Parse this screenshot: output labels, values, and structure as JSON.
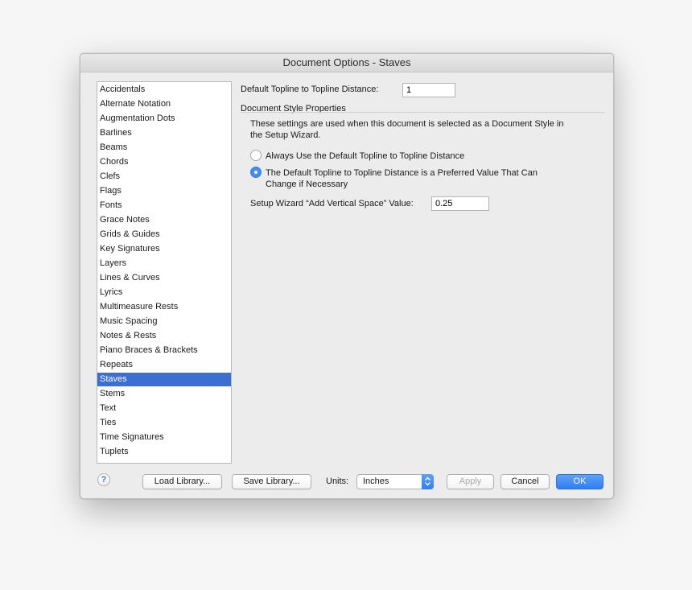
{
  "window": {
    "title": "Document Options - Staves"
  },
  "categories": [
    "Accidentals",
    "Alternate Notation",
    "Augmentation Dots",
    "Barlines",
    "Beams",
    "Chords",
    "Clefs",
    "Flags",
    "Fonts",
    "Grace Notes",
    "Grids & Guides",
    "Key Signatures",
    "Layers",
    "Lines & Curves",
    "Lyrics",
    "Multimeasure Rests",
    "Music Spacing",
    "Notes & Rests",
    "Piano Braces & Brackets",
    "Repeats",
    "Staves",
    "Stems",
    "Text",
    "Ties",
    "Time Signatures",
    "Tuplets"
  ],
  "selected_category": "Staves",
  "settings": {
    "topline_label": "Default Topline to Topline Distance:",
    "topline_value": "1",
    "section_title": "Document Style Properties",
    "description": "These settings are used when this document is selected as a Document Style in the Setup Wizard.",
    "radio_always_label": "Always Use the Default Topline to Topline Distance",
    "radio_preferred_label_line1": "The Default Topline to Topline Distance is a Preferred Value That Can",
    "radio_preferred_label_line2": "Change if Necessary",
    "selected_radio": "preferred",
    "wizard_label": "Setup Wizard “Add Vertical Space” Value:",
    "wizard_value": "0.25"
  },
  "footer": {
    "help_symbol": "?",
    "load_library": "Load Library...",
    "save_library": "Save Library...",
    "units_label": "Units:",
    "units_value": "Inches",
    "apply": "Apply",
    "cancel": "Cancel",
    "ok": "OK"
  },
  "colors": {
    "selection": "#3c6fd3",
    "accent": "#3f8ef5"
  }
}
